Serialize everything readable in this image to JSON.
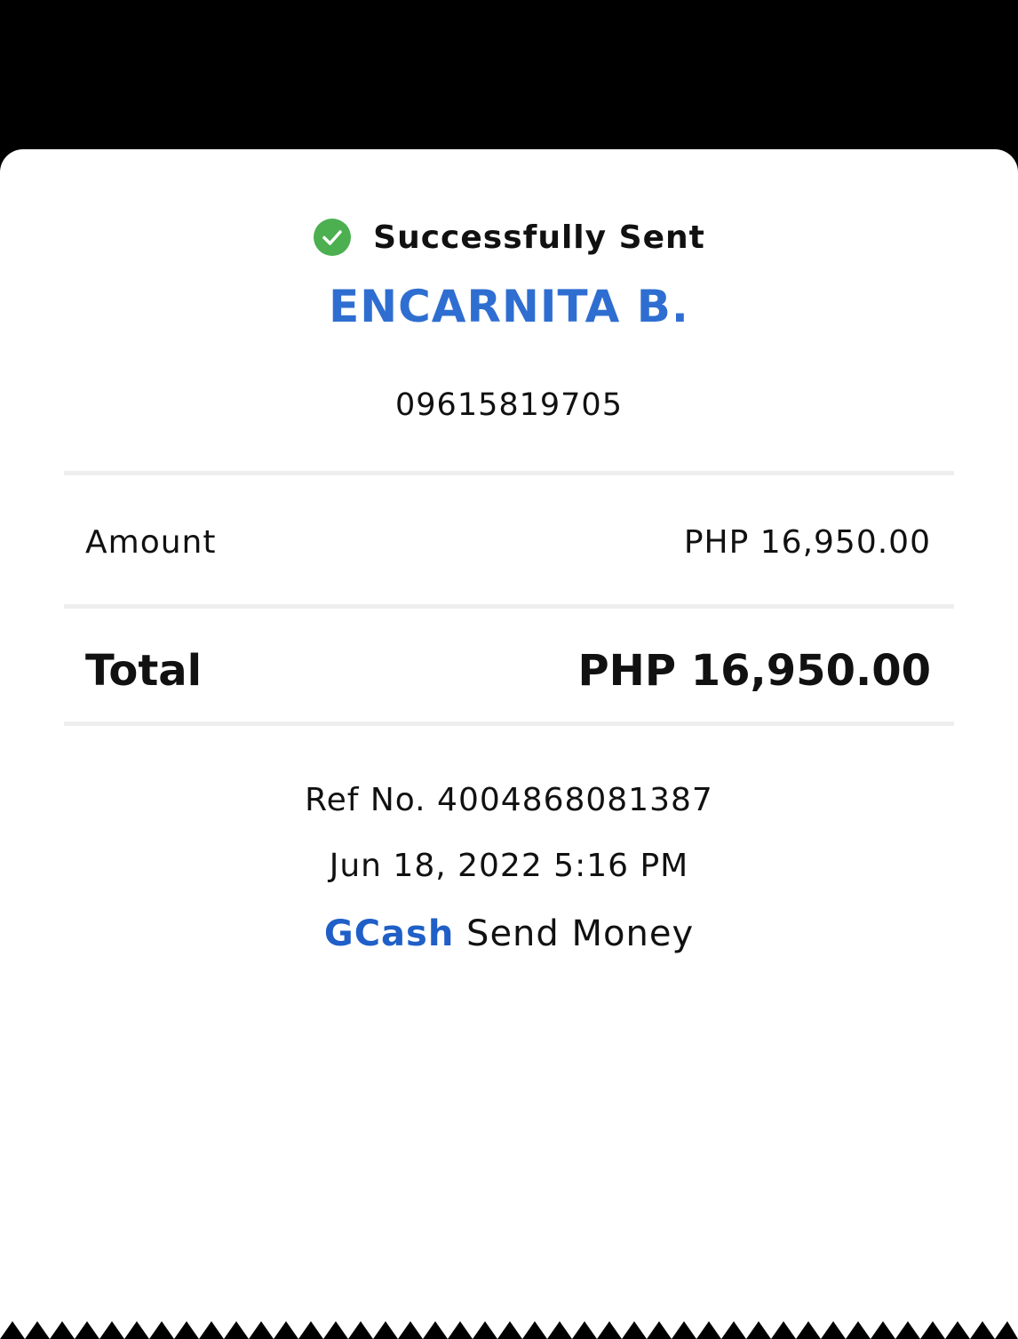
{
  "status": {
    "text": "Successfully Sent",
    "icon": "check-circle-icon",
    "color": "#4caf50"
  },
  "recipient": {
    "name": "ENCARNITA B.",
    "phone": "09615819705",
    "name_color": "#2f6ed1"
  },
  "amount": {
    "label": "Amount",
    "value": "PHP 16,950.00"
  },
  "total": {
    "label": "Total",
    "value": "PHP 16,950.00"
  },
  "reference": {
    "text": "Ref No. 4004868081387"
  },
  "datetime": {
    "text": "Jun 18, 2022 5:16 PM"
  },
  "footer": {
    "brand": "GCash",
    "service": "Send Money",
    "brand_color": "#1f5fc7"
  }
}
